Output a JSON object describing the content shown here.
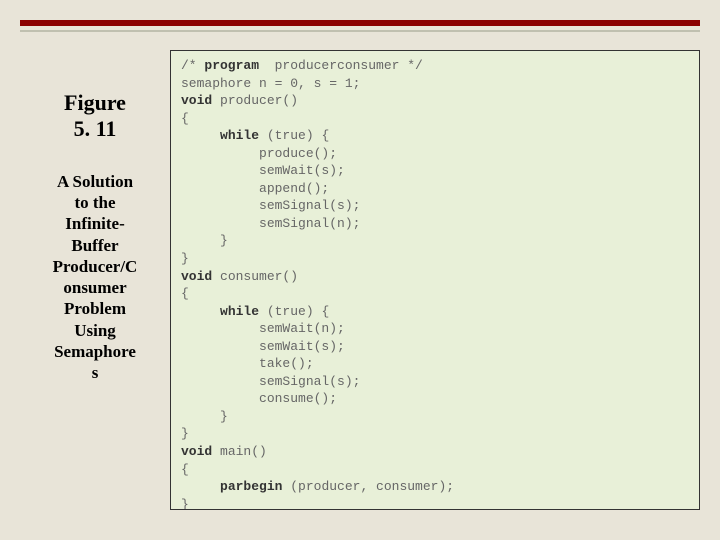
{
  "figure": {
    "label_line1": "Figure",
    "label_line2": "5. 11",
    "caption_l1": "A Solution",
    "caption_l2": "to the",
    "caption_l3": "Infinite-",
    "caption_l4": "Buffer",
    "caption_l5": "Producer/C",
    "caption_l6": "onsumer",
    "caption_l7": "Problem",
    "caption_l8": "Using",
    "caption_l9": "Semaphore",
    "caption_l10": "s"
  },
  "code": {
    "l01a": "/* ",
    "l01b": "program",
    "l01c": "  producerconsumer */",
    "l02": "semaphore n = 0, s = 1;",
    "l03a": "void ",
    "l03b": "producer()",
    "l04": "{",
    "l05a": "     ",
    "l05b": "while",
    "l05c": " (true) {",
    "l06": "          produce();",
    "l07": "          semWait(s);",
    "l08": "          append();",
    "l09": "          semSignal(s);",
    "l10": "          semSignal(n);",
    "l11": "     }",
    "l12": "}",
    "l13a": "void ",
    "l13b": "consumer()",
    "l14": "{",
    "l15a": "     ",
    "l15b": "while",
    "l15c": " (true) {",
    "l16": "          semWait(n);",
    "l17": "          semWait(s);",
    "l18": "          take();",
    "l19": "          semSignal(s);",
    "l20": "          consume();",
    "l21": "     }",
    "l22": "}",
    "l23a": "void ",
    "l23b": "main()",
    "l24": "{",
    "l25a": "     ",
    "l25b": "parbegin",
    "l25c": " (producer, consumer);",
    "l26": "}"
  }
}
